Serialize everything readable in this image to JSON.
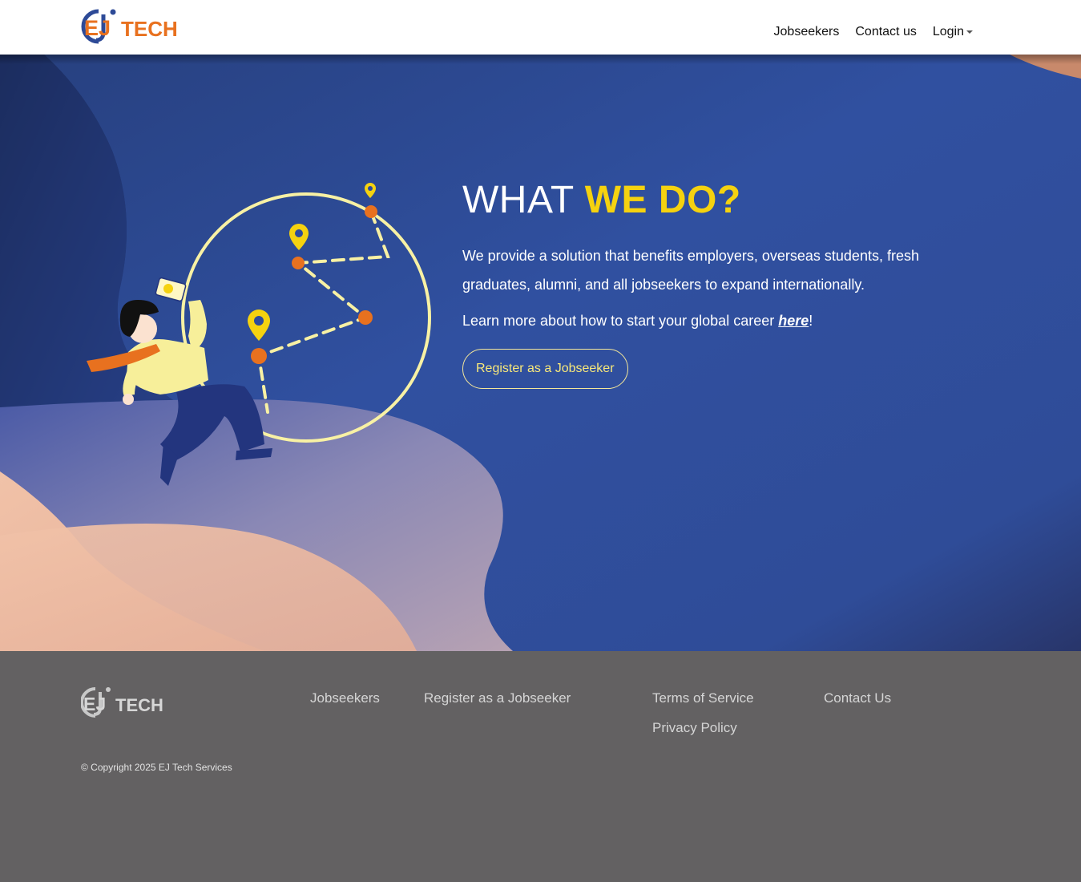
{
  "brand": {
    "logo_letters": "EJ",
    "logo_word": "TECH"
  },
  "nav": {
    "items": [
      {
        "label": "Jobseekers"
      },
      {
        "label": "Contact us"
      },
      {
        "label": "Login"
      }
    ]
  },
  "hero": {
    "title_plain": "WHAT ",
    "title_accent": "WE DO?",
    "description": "We provide a solution that benefits employers, overseas students, fresh graduates, alumni, and all jobseekers to expand internationally.",
    "learn_prefix": "Learn more about how to start your global career ",
    "learn_link": "here",
    "learn_suffix": "!",
    "cta_label": "Register as a Jobseeker"
  },
  "footer": {
    "links": {
      "jobseekers": "Jobseekers",
      "register": "Register as a Jobseeker",
      "terms": "Terms of Service",
      "privacy": "Privacy Policy",
      "contact": "Contact Us"
    },
    "copyright": "© Copyright 2025 EJ Tech Services"
  },
  "colors": {
    "hero_blue": "#2e4b9c",
    "accent_yellow": "#f5d20f",
    "brand_orange": "#e8711f",
    "brand_blue": "#2d4a97",
    "footer_gray": "#636162"
  }
}
